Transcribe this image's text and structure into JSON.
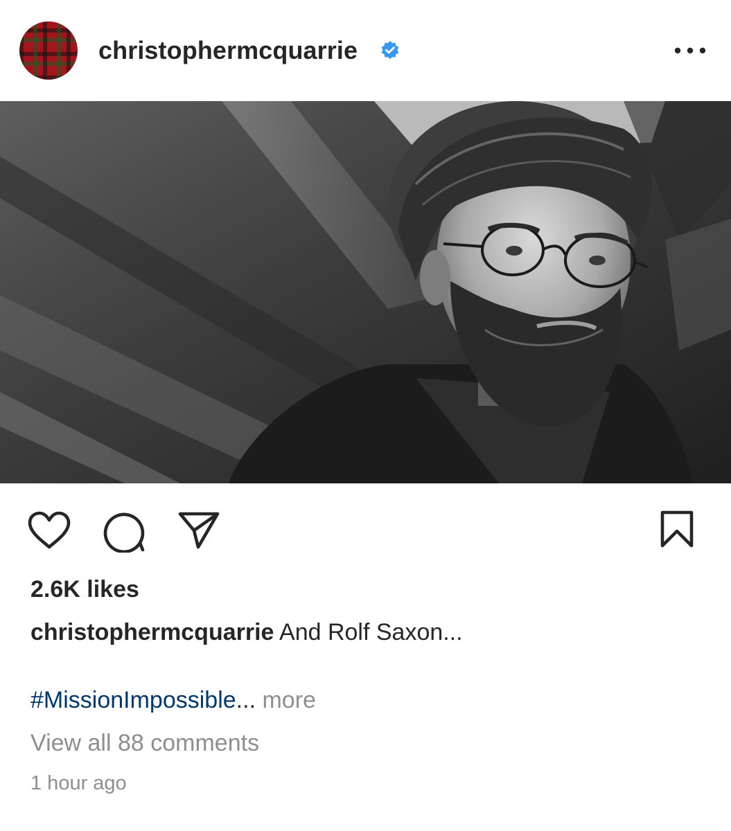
{
  "post": {
    "username": "christophermcquarrie",
    "verified": true,
    "avatar_icon": "tartan-avatar",
    "more_icon": "more-horizontal-icon"
  },
  "photo": {
    "style": "black-and-white portrait"
  },
  "actions": {
    "like_icon": "heart-icon",
    "comment_icon": "comment-icon",
    "share_icon": "share-icon",
    "save_icon": "bookmark-icon"
  },
  "engagement": {
    "likes": "2.6K likes"
  },
  "caption": {
    "username": "christophermcquarrie",
    "text": "And Rolf Saxon...",
    "hashtag": "#MissionImpossible",
    "ellipsis": "...",
    "more_label": "more"
  },
  "comments": {
    "view_all": "View all 88 comments"
  },
  "timestamp": "1 hour ago",
  "colors": {
    "text": "#262626",
    "muted": "#8e8e8e",
    "link": "#00376b",
    "verified": "#3897f0"
  }
}
